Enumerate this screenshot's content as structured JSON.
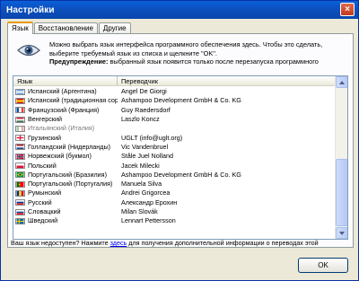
{
  "window": {
    "title": "Настройки",
    "close_label": "×"
  },
  "tabs": [
    {
      "label": "Язык",
      "active": true
    },
    {
      "label": "Восстановление",
      "active": false
    },
    {
      "label": "Другие",
      "active": false
    }
  ],
  "intro": {
    "text": "Можно выбрать язык интерфейса программного обеспечения здесь. Чтобы это сделать, выберите требуемый язык из списка и щелкните \"OK\".",
    "warning_label": "Предупреждение:",
    "warning_text": " выбранный язык появится только после перезапуска программного"
  },
  "list": {
    "columns": {
      "language": "Язык",
      "translator": "Переводчик"
    },
    "rows": [
      {
        "language": "Испанский (Аргентина)",
        "translator": "Angel De Giorgi",
        "flag": "ar",
        "gray": false
      },
      {
        "language": "Испанский (традиционная сорт...",
        "translator": "Ashampoo Development GmbH & Co. KG",
        "flag": "es",
        "gray": false
      },
      {
        "language": "Французский (Франция)",
        "translator": "Guy Raedersdorf",
        "flag": "fr",
        "gray": false
      },
      {
        "language": "Венгерский",
        "translator": "Laszlo Koncz",
        "flag": "hu",
        "gray": false
      },
      {
        "language": "Итальянский (Италия)",
        "translator": "",
        "flag": "it",
        "gray": true
      },
      {
        "language": "Грузинский",
        "translator": "UGLT (info@uglt.org)",
        "flag": "ge",
        "gray": false
      },
      {
        "language": "Голландский (Нидерланды)",
        "translator": "Vic Vandenbruel",
        "flag": "nl",
        "gray": false
      },
      {
        "language": "Норвежский (букмол)",
        "translator": "Ståle Juel Nolland",
        "flag": "no",
        "gray": false
      },
      {
        "language": "Польский",
        "translator": "Jacek Milecki",
        "flag": "pl",
        "gray": false
      },
      {
        "language": "Португальский (Бразилия)",
        "translator": "Ashampoo Development GmbH & Co. KG",
        "flag": "br",
        "gray": false
      },
      {
        "language": "Португальский (Португалия)",
        "translator": "Manuela Silva",
        "flag": "pt",
        "gray": false
      },
      {
        "language": "Румынский",
        "translator": "Andrei Grigorcea",
        "flag": "ro",
        "gray": false
      },
      {
        "language": "Русский",
        "translator": "Александр Ерохин",
        "flag": "ru",
        "gray": false
      },
      {
        "language": "Словацкий",
        "translator": "Milan Slovák",
        "flag": "sk",
        "gray": false
      },
      {
        "language": "Шведский",
        "translator": "Lennart Pettersson",
        "flag": "se",
        "gray": false
      }
    ]
  },
  "help": {
    "before": "Ваш язык недоступен? Нажмите ",
    "link": "здесь",
    "after": " для получения дополнительной информации о переводах этой"
  },
  "buttons": {
    "ok": "OK"
  },
  "colors": {
    "title_bar": "#0b4fbd",
    "tab_highlight": "#e69b0a",
    "link": "#0000ee"
  }
}
